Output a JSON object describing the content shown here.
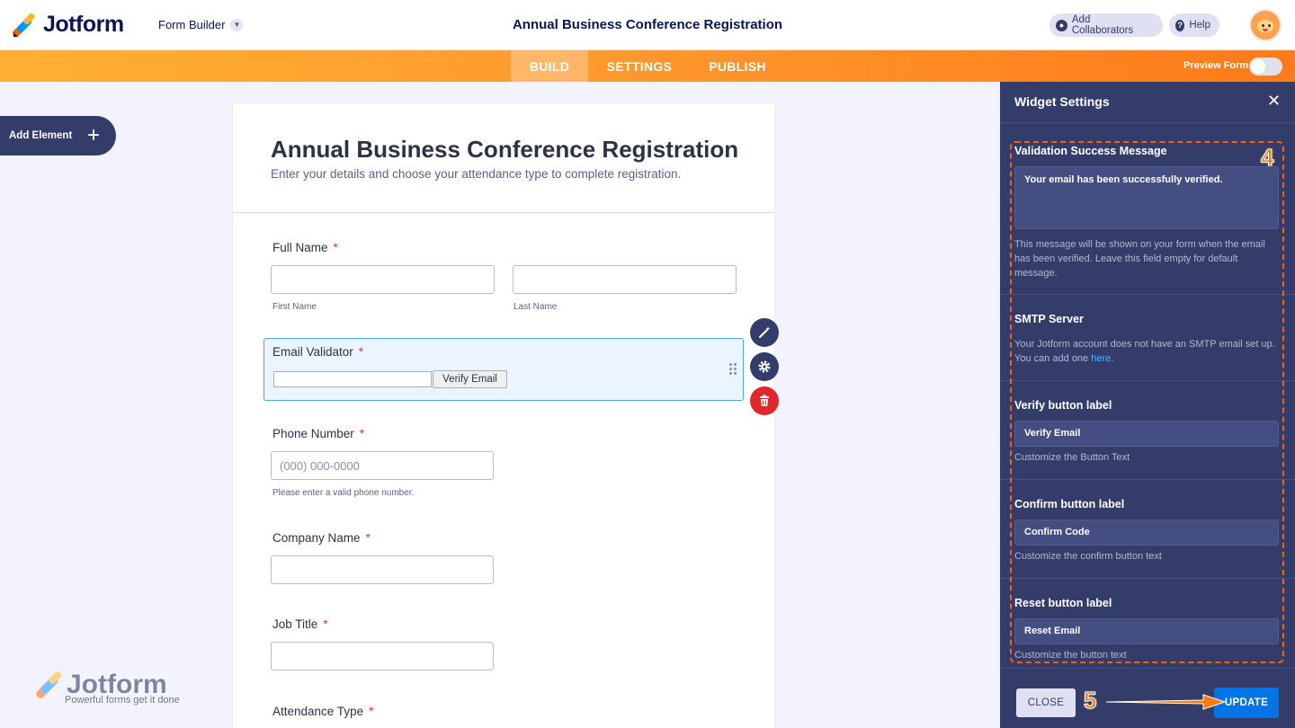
{
  "app": {
    "logo_text": "Jotform",
    "builder_mode": "Form Builder",
    "form_title": "Annual Business Conference Registration",
    "add_collaborators": "Add Collaborators",
    "help": "Help"
  },
  "nav": {
    "tabs": [
      {
        "label": "BUILD",
        "active": true
      },
      {
        "label": "SETTINGS",
        "active": false
      },
      {
        "label": "PUBLISH",
        "active": false
      }
    ],
    "preview_label": "Preview Form",
    "preview_on": false
  },
  "sidebar": {
    "add_element": "Add Element"
  },
  "form": {
    "title": "Annual Business Conference Registration",
    "subtitle": "Enter your details and choose your attendance type to complete registration.",
    "full_name": {
      "label": "Full Name",
      "required": "*",
      "first_sub": "First Name",
      "last_sub": "Last Name"
    },
    "email_validator": {
      "label": "Email Validator",
      "required": "*",
      "button": "Verify Email"
    },
    "phone": {
      "label": "Phone Number",
      "required": "*",
      "placeholder": "(000) 000-0000",
      "hint": "Please enter a valid phone number."
    },
    "company": {
      "label": "Company Name",
      "required": "*"
    },
    "job_title": {
      "label": "Job Title",
      "required": "*"
    },
    "attendance": {
      "label": "Attendance Type",
      "required": "*"
    }
  },
  "watermark": {
    "brand": "Jotform",
    "tagline": "Powerful forms get it done"
  },
  "panel": {
    "title": "Widget Settings",
    "sections": {
      "success": {
        "title": "Validation Success Message",
        "value": "Your email has been successfully verified.",
        "desc": "This message will be shown on your form when the email has been verified. Leave this field empty for default message."
      },
      "smtp": {
        "title": "SMTP Server",
        "desc": "Your Jotform account does not have an SMTP email set up. You can add one ",
        "link": "here",
        "desc_end": "."
      },
      "verify": {
        "title": "Verify button label",
        "value": "Verify Email",
        "desc": "Customize the Button Text"
      },
      "confirm": {
        "title": "Confirm button label",
        "value": "Confirm Code",
        "desc": "Customize the confirm button text"
      },
      "reset": {
        "title": "Reset button label",
        "value": "Reset Email",
        "desc": "Customize the button text"
      }
    },
    "close_label": "CLOSE",
    "update_label": "UPDATE"
  },
  "annotations": {
    "step4": "4",
    "step5": "5"
  },
  "colors": {
    "accent_orange": "#ff6100",
    "navy": "#343c6a",
    "primary_blue": "#0075e3",
    "required_red": "#e22f2f"
  }
}
